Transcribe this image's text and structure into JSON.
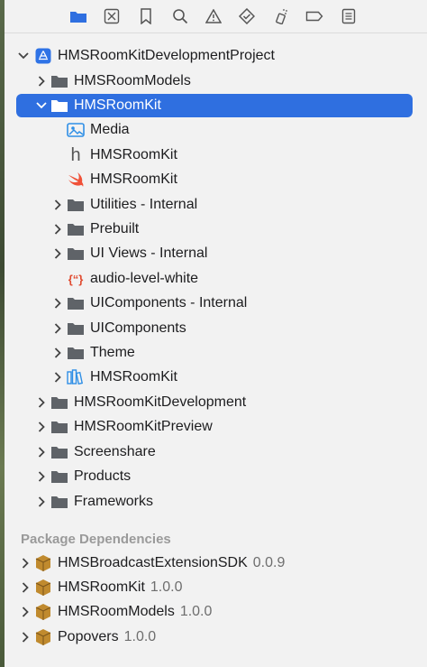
{
  "colors": {
    "accent": "#2f6fe0",
    "toolbar_active": "#2f6fe0",
    "folder": "#5f6368",
    "swift": "#f05138",
    "package": "#b8862e",
    "section": "#9a9a9a"
  },
  "toolbar": {
    "icons": [
      "folder-icon",
      "source-control-icon",
      "bookmark-icon",
      "search-icon",
      "warning-icon",
      "test-diamond-icon",
      "debug-spray-icon",
      "breakpoint-icon",
      "report-list-icon"
    ]
  },
  "tree": {
    "project": "HMSRoomKitDevelopmentProject",
    "models": "HMSRoomModels",
    "roomkit": "HMSRoomKit",
    "media": "Media",
    "header_file": "HMSRoomKit",
    "swift_file": "HMSRoomKit",
    "utilities": "Utilities - Internal",
    "prebuilt": "Prebuilt",
    "ui_views": "UI Views - Internal",
    "audio_level": "audio-level-white",
    "uicomponents_internal": "UIComponents - Internal",
    "uicomponents": "UIComponents",
    "theme": "Theme",
    "library": "HMSRoomKit",
    "development": "HMSRoomKitDevelopment",
    "preview": "HMSRoomKitPreview",
    "screenshare": "Screenshare",
    "products": "Products",
    "frameworks": "Frameworks"
  },
  "packages": {
    "title": "Package Dependencies",
    "items": [
      {
        "name": "HMSBroadcastExtensionSDK",
        "version": "0.0.9"
      },
      {
        "name": "HMSRoomKit",
        "version": "1.0.0"
      },
      {
        "name": "HMSRoomModels",
        "version": "1.0.0"
      },
      {
        "name": "Popovers",
        "version": "1.0.0"
      }
    ]
  }
}
